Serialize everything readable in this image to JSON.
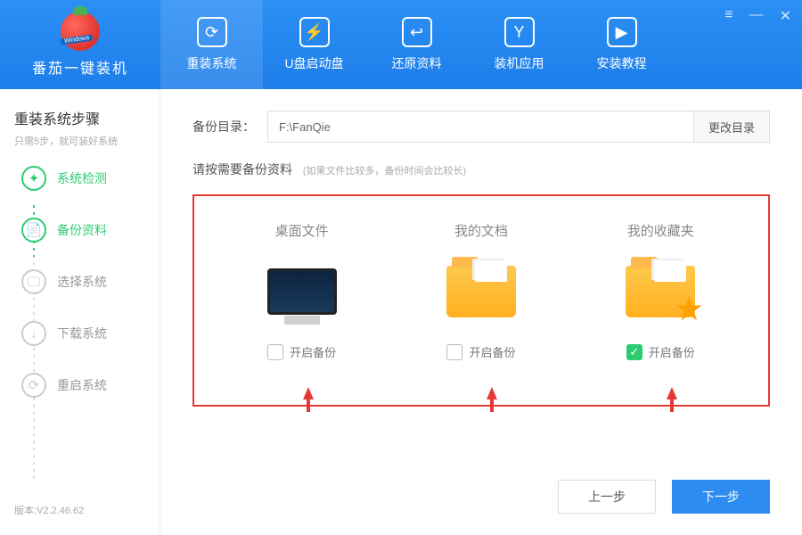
{
  "app": {
    "title": "番茄一键装机",
    "logo_banner": "Windows"
  },
  "window_controls": {
    "menu": "≡",
    "min": "—",
    "close": "✕"
  },
  "tabs": [
    {
      "label": "重装系统",
      "glyph": "⟳"
    },
    {
      "label": "U盘启动盘",
      "glyph": "⚡"
    },
    {
      "label": "还原资料",
      "glyph": "↩"
    },
    {
      "label": "装机应用",
      "glyph": "Y"
    },
    {
      "label": "安装教程",
      "glyph": "▶"
    }
  ],
  "sidebar": {
    "title": "重装系统步骤",
    "subtitle": "只需5步，就可装好系统",
    "steps": [
      {
        "label": "系统检测",
        "state": "done",
        "glyph": "✦"
      },
      {
        "label": "备份资料",
        "state": "active",
        "glyph": "📄"
      },
      {
        "label": "选择系统",
        "state": "pending",
        "glyph": "🖵"
      },
      {
        "label": "下载系统",
        "state": "pending",
        "glyph": "↓"
      },
      {
        "label": "重启系统",
        "state": "pending",
        "glyph": "⟳"
      }
    ],
    "version": "版本:V2.2.46.62"
  },
  "content": {
    "dir_label": "备份目录：",
    "dir_value": "F:\\FanQie",
    "change_dir": "更改目录",
    "prompt": "请按需要备份资料",
    "prompt_note": "(如果文件比较多，备份时间会比较长)",
    "items": [
      {
        "title": "桌面文件",
        "check_label": "开启备份",
        "checked": false
      },
      {
        "title": "我的文档",
        "check_label": "开启备份",
        "checked": false
      },
      {
        "title": "我的收藏夹",
        "check_label": "开启备份",
        "checked": true
      }
    ],
    "prev": "上一步",
    "next": "下一步"
  }
}
